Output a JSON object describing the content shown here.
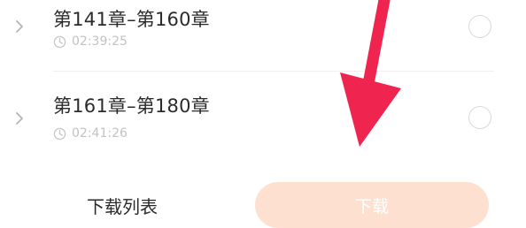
{
  "chapters": [
    {
      "title": "第141章–第160章",
      "duration": "02:39:25"
    },
    {
      "title": "第161章–第180章",
      "duration": "02:41:26"
    }
  ],
  "bottom_bar": {
    "download_list_label": "下载列表",
    "download_button_label": "下载"
  },
  "colors": {
    "accent_disabled": "#fde0cf",
    "annotation_arrow": "#f0254f"
  },
  "icons": [
    "chevron-right-icon",
    "clock-icon",
    "radio-unchecked-icon",
    "annotation-arrow-icon"
  ]
}
